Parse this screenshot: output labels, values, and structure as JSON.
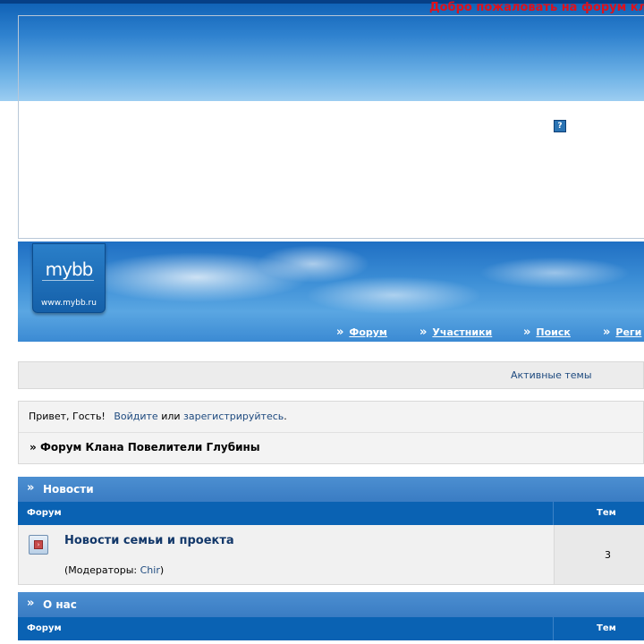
{
  "header": {
    "welcome_text": "Добро пожаловать на форум кл",
    "help_icon_label": "?"
  },
  "logo": {
    "mark": "mybb",
    "url": "www.mybb.ru"
  },
  "nav": {
    "items": [
      {
        "label": "Форум"
      },
      {
        "label": "Участники"
      },
      {
        "label": "Поиск"
      },
      {
        "label": "Реги"
      }
    ],
    "arrow": "»"
  },
  "status_bar": {
    "active_topics": "Активные темы"
  },
  "greeting": {
    "hello": "Привет, Гость!",
    "login": "Войдите",
    "or": "или",
    "register": "зарегистрируйтесь",
    "end": "."
  },
  "breadcrumb": {
    "prefix": "»",
    "title": "Форум Клана Повелители Глубины"
  },
  "categories": [
    {
      "title": "Новости",
      "col_forum": "Форум",
      "col_topics": "Тем",
      "forums": [
        {
          "title": "Новости семьи и проекта",
          "mods_prefix": "(Модераторы:",
          "mods_name": "Chir",
          "mods_suffix": ")",
          "topics": "3"
        }
      ]
    },
    {
      "title": "О нас",
      "col_forum": "Форум",
      "col_topics": "Тем"
    }
  ],
  "colors": {
    "welcome": "#e0101a",
    "category_header": "#3a7cc3",
    "column_header": "#0a62b3",
    "link": "#1e4a7f"
  }
}
